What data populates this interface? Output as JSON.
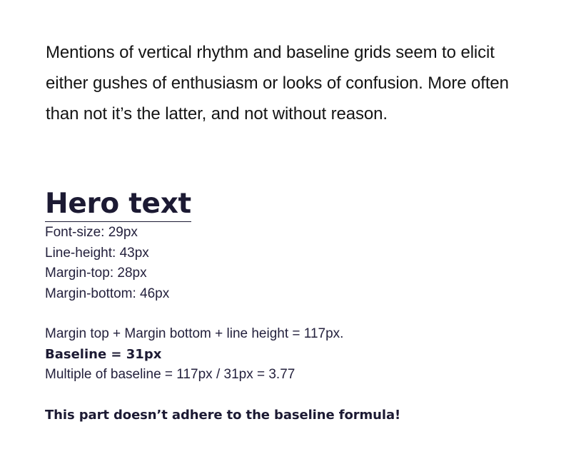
{
  "intro": {
    "paragraph": "Mentions of vertical rhythm and baseline grids seem to elicit either gushes of enthusiasm or looks of confusion. More often than not it’s the latter, and not without reason."
  },
  "hero": {
    "title": "Hero text",
    "specs": [
      "Font-size: 29px",
      "Line-height: 43px",
      "Margin-top: 28px",
      "Margin-bottom: 46px"
    ]
  },
  "calculation": {
    "sum": "Margin top + Margin bottom + line height = 117px.",
    "baseline": "Baseline = 31px",
    "multiple": "Multiple of baseline = 117px / 31px = 3.77"
  },
  "note": "This part doesn’t adhere to the baseline formula!",
  "colors": {
    "heading": "#1c1a33",
    "body_text": "#141414",
    "spec_text": "#24213d",
    "background": "#ffffff"
  }
}
